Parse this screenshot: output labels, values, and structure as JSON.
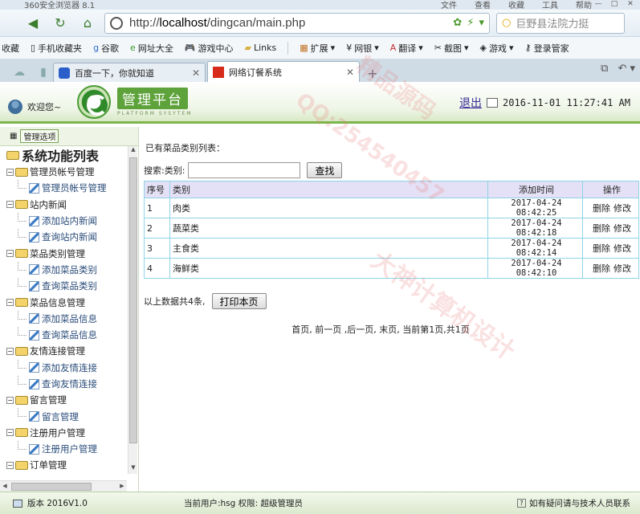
{
  "browser": {
    "title": "360安全浏览器 8.1",
    "menus": [
      "文件",
      "查看",
      "收藏",
      "工具",
      "帮助"
    ],
    "url_prefix": "http://",
    "url_host": "localhost",
    "url_path": "/dingcan/main.php",
    "search_placeholder": "巨野县法院力挺",
    "bookmarks": [
      "收藏",
      "手机收藏夹",
      "谷歌",
      "网址大全",
      "游戏中心",
      "Links",
      "扩展",
      "网银",
      "翻译",
      "截图",
      "游戏",
      "登录管家"
    ],
    "tabs": [
      {
        "label": "百度一下，你就知道",
        "active": false
      },
      {
        "label": "网络订餐系统",
        "active": true
      }
    ]
  },
  "header": {
    "welcome": "欢迎您~",
    "platform_cn": "管理平台",
    "platform_en": "PLATFORM SYSYTEM",
    "logout": "退出",
    "datetime": "2016-11-01 11:27:41 AM"
  },
  "sidebar": {
    "tab_label": "管理选项",
    "root": "系统功能列表",
    "groups": [
      {
        "label": "管理员帐号管理",
        "items": [
          "管理员帐号管理"
        ]
      },
      {
        "label": "站内新闻",
        "items": [
          "添加站内新闻",
          "查询站内新闻"
        ]
      },
      {
        "label": "菜品类别管理",
        "items": [
          "添加菜品类别",
          "查询菜品类别"
        ]
      },
      {
        "label": "菜品信息管理",
        "items": [
          "添加菜品信息",
          "查询菜品信息"
        ]
      },
      {
        "label": "友情连接管理",
        "items": [
          "添加友情连接",
          "查询友情连接"
        ]
      },
      {
        "label": "留言管理",
        "items": [
          "留言管理"
        ]
      },
      {
        "label": "注册用户管理",
        "items": [
          "注册用户管理"
        ]
      },
      {
        "label": "订单管理",
        "items": []
      }
    ]
  },
  "content": {
    "title": "已有菜品类别列表：",
    "search_label": "搜索:类别:",
    "search_value": "",
    "search_button": "查找",
    "columns": [
      "序号",
      "类别",
      "添加时间",
      "操作"
    ],
    "rows": [
      {
        "no": "1",
        "category": "肉类",
        "time": "2017-04-24 08:42:25"
      },
      {
        "no": "2",
        "category": "蔬菜类",
        "time": "2017-04-24 08:42:18"
      },
      {
        "no": "3",
        "category": "主食类",
        "time": "2017-04-24 08:42:14"
      },
      {
        "no": "4",
        "category": "海鲜类",
        "time": "2017-04-24 08:42:10"
      }
    ],
    "delete_label": "删除",
    "edit_label": "修改",
    "summary": "以上数据共4条,",
    "print_button": "打印本页",
    "pager": "首页, 前一页 ,后一页, 末页, 当前第1页,共1页"
  },
  "statusbar": {
    "version": "版本 2016V1.0",
    "current_user": "当前用户:hsg 权限: 超级管理员",
    "help": "如有疑问请与技术人员联系"
  },
  "watermarks": [
    "QQ:254540457",
    "大神计算机设计",
    "精品源码"
  ]
}
